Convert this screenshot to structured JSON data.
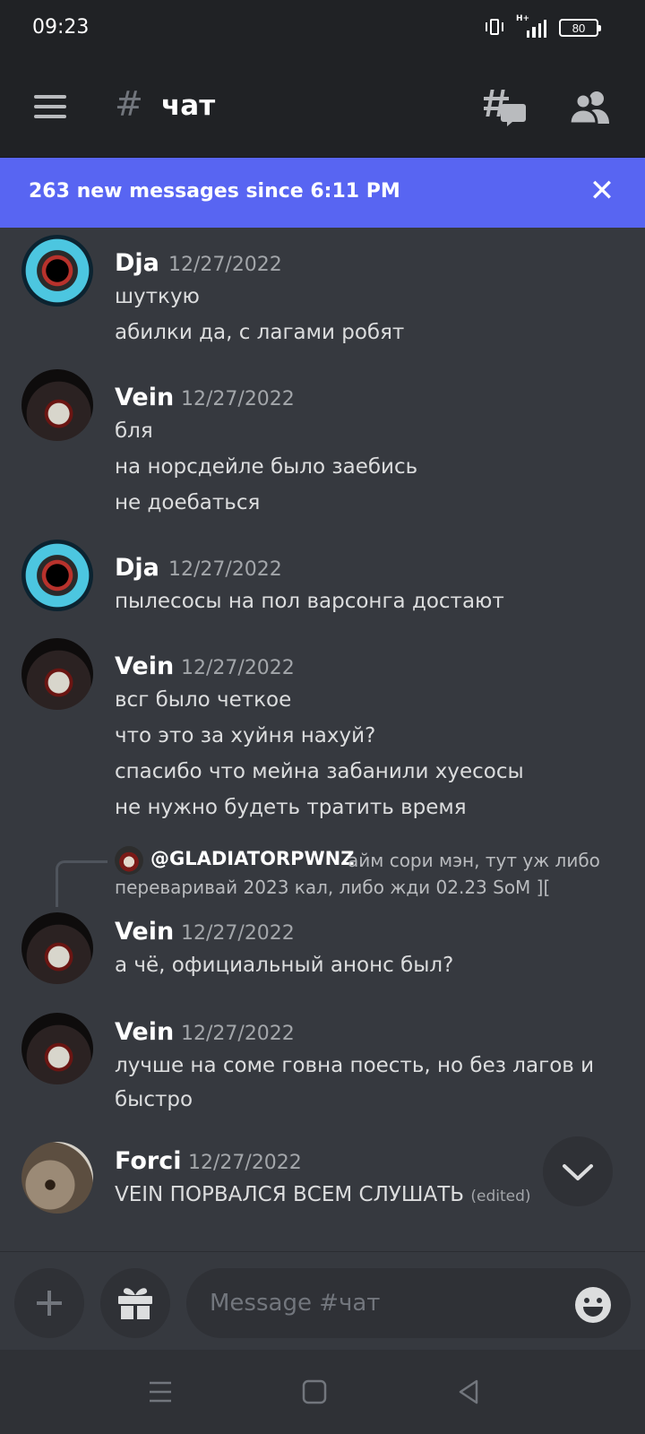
{
  "status_bar": {
    "time": "09:23",
    "battery": "80",
    "network": "H+"
  },
  "header": {
    "hash": "#",
    "channel_name": "чат"
  },
  "banner": {
    "text": "263 new messages since 6:11 PM",
    "close": "✕"
  },
  "messages": [
    {
      "author": "Dja",
      "timestamp": "12/27/2022",
      "lines": [
        "шуткую",
        "абилки да, с лагами робят"
      ]
    },
    {
      "author": "Vein",
      "timestamp": "12/27/2022",
      "lines": [
        "бля",
        "на норсдейле было заебись",
        "не доебаться"
      ]
    },
    {
      "author": "Dja",
      "timestamp": "12/27/2022",
      "lines": [
        "пылесосы на пол варсонга достают"
      ]
    },
    {
      "author": "Vein",
      "timestamp": "12/27/2022",
      "lines": [
        "всг было четкое",
        "что это за хуйня нахуй?",
        "спасибо что мейна забанили хуесосы",
        "не нужно будеть тратить время"
      ]
    },
    {
      "reply": {
        "name": "@GLADIATORPWNZ",
        "text_1": "айм сори мэн, тут уж либо",
        "text_2": "переваривай 2023 кал, либо жди 02.23 SoM ]["
      },
      "author": "Vein",
      "timestamp": "12/27/2022",
      "lines": [
        "а чё, официальный анонс был?"
      ]
    },
    {
      "author": "Vein",
      "timestamp": "12/27/2022",
      "lines": [
        "лучше на соме говна поесть, но без лагов и",
        "быстро"
      ]
    },
    {
      "author": "Forci",
      "timestamp": "12/27/2022",
      "lines": [
        "VEIN ПОРВАЛСЯ ВСЕМ СЛУШАТЬ"
      ],
      "edited": "(edited)"
    }
  ],
  "composer": {
    "placeholder": "Message #чат"
  },
  "colors": {
    "accent": "#5865f2",
    "background": "#36393f",
    "header": "#202225"
  }
}
